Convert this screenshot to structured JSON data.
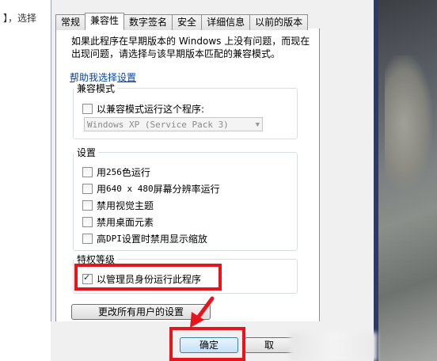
{
  "background": {
    "left_text": "】，选择"
  },
  "tabs": [
    {
      "label": "常规",
      "active": false
    },
    {
      "label": "兼容性",
      "active": true
    },
    {
      "label": "数字签名",
      "active": false
    },
    {
      "label": "安全",
      "active": false
    },
    {
      "label": "详细信息",
      "active": false
    },
    {
      "label": "以前的版本",
      "active": false
    }
  ],
  "description": "如果此程序在早期版本的 Windows 上没有问题，而现在出现问题，请选择与该早期版本匹配的兼容模式。",
  "help_link": "帮助我选择设置",
  "compat_mode": {
    "title": "兼容模式",
    "checkbox_label": "以兼容模式运行这个程序:",
    "checked": false,
    "os_select_value": "Windows XP (Service Pack 3)"
  },
  "settings": {
    "title": "设置",
    "items": [
      {
        "pre": "用 ",
        "mono": "256",
        "post": " 色运行",
        "checked": false
      },
      {
        "pre": "用 ",
        "mono": "640 x 480",
        "post": " 屏幕分辨率运行",
        "checked": false
      },
      {
        "pre": "禁用视觉主题",
        "mono": "",
        "post": "",
        "checked": false
      },
      {
        "pre": "禁用桌面元素",
        "mono": "",
        "post": "",
        "checked": false
      },
      {
        "pre": "高 ",
        "mono": "DPI",
        "post": " 设置时禁用显示缩放",
        "checked": false
      }
    ]
  },
  "privilege": {
    "title": "特权等级",
    "checkbox_label": "以管理员身份运行此程序",
    "checked": true
  },
  "buttons": {
    "change_all_users": "更改所有用户的设置",
    "ok": "确定",
    "cancel": "取"
  },
  "colors": {
    "annotation_red": "#e8141c",
    "link_blue": "#0645ad"
  }
}
